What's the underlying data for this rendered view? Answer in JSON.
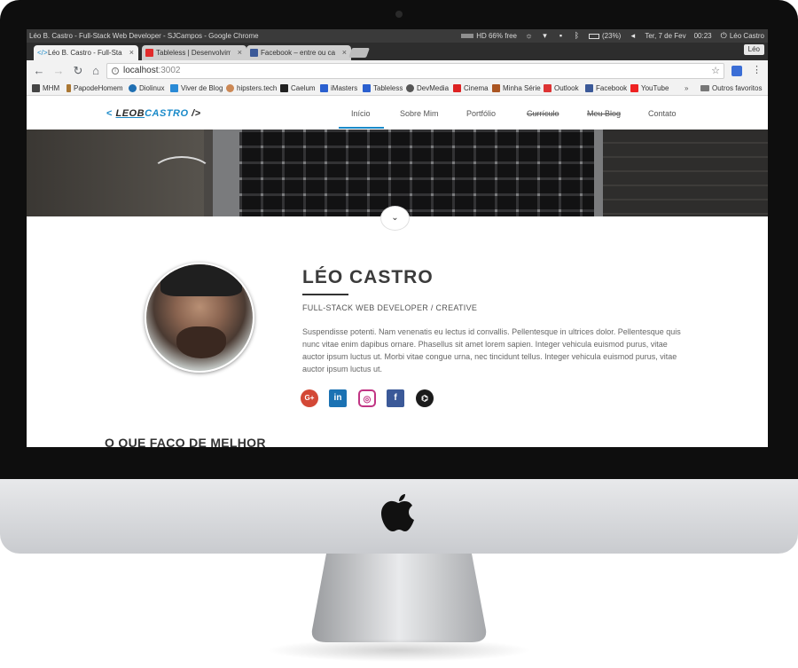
{
  "os": {
    "window_title": "Léo B. Castro - Full-Stack Web Developer - SJCampos - Google Chrome",
    "hd_status": "HD 66% free",
    "battery": "(23%)",
    "datetime": "Ter, 7 de Fev",
    "time": "00:23",
    "user": "Léo Castro"
  },
  "browser": {
    "profile": "Léo",
    "tabs": [
      {
        "title": "Léo B. Castro - Full-Stack",
        "favicon_color": "#1a8ac9"
      },
      {
        "title": "Tableless | Desenvolvim",
        "favicon_color": "#e22b2b"
      },
      {
        "title": "Facebook – entre ou ca",
        "favicon_color": "#3b5998"
      }
    ],
    "url": "localhost",
    "url_port": ":3002",
    "bookmarks": [
      {
        "label": "MHM",
        "color": "#444"
      },
      {
        "label": "PapodeHomem",
        "color": "#aa7733"
      },
      {
        "label": "Diolinux",
        "color": "#1f6fb2"
      },
      {
        "label": "Viver de Blog",
        "color": "#2a8ad6"
      },
      {
        "label": "hipsters.tech",
        "color": "#cc8855"
      },
      {
        "label": "Caelum",
        "color": "#222"
      },
      {
        "label": "iMasters",
        "color": "#2a5fcf"
      },
      {
        "label": "Tableless",
        "color": "#2a5fcf"
      },
      {
        "label": "DevMedia",
        "color": "#555"
      },
      {
        "label": "Cinema",
        "color": "#d22"
      },
      {
        "label": "Minha Série",
        "color": "#aa5522"
      },
      {
        "label": "Outlook",
        "color": "#d33"
      },
      {
        "label": "Facebook",
        "color": "#3b5998"
      },
      {
        "label": "YouTube",
        "color": "#e22"
      }
    ],
    "bookmarks_more": "»",
    "other_bookmarks": "Outros favoritos"
  },
  "site": {
    "logo_open": "<",
    "logo_first": "LEOB",
    "logo_last": "CASTRO",
    "logo_close": "/>",
    "nav": [
      "Início",
      "Sobre Mim",
      "Portfólio",
      "Currículo",
      "Meu Blog",
      "Contato"
    ],
    "scroll_glyph": "⌄",
    "name": "LÉO CASTRO",
    "role": "FULL-STACK WEB DEVELOPER / CREATIVE",
    "bio": "Suspendisse potenti. Nam venenatis eu lectus id convallis. Pellentesque in ultrices dolor. Pellentesque quis nunc vitae enim dapibus ornare. Phasellus sit amet lorem sapien. Integer vehicula euismod purus, vitae auctor ipsum luctus ut. Morbi vitae congue urna, nec tincidunt tellus. Integer vehicula euismod purus, vitae auctor ipsum luctus ut.",
    "socials": [
      {
        "name": "google-plus",
        "glyph": "G+"
      },
      {
        "name": "linkedin",
        "glyph": "in"
      },
      {
        "name": "instagram",
        "glyph": "◎"
      },
      {
        "name": "facebook",
        "glyph": "f"
      },
      {
        "name": "github",
        "glyph": "⌬"
      }
    ],
    "section_title": "O QUE FAÇO DE MELHOR"
  }
}
